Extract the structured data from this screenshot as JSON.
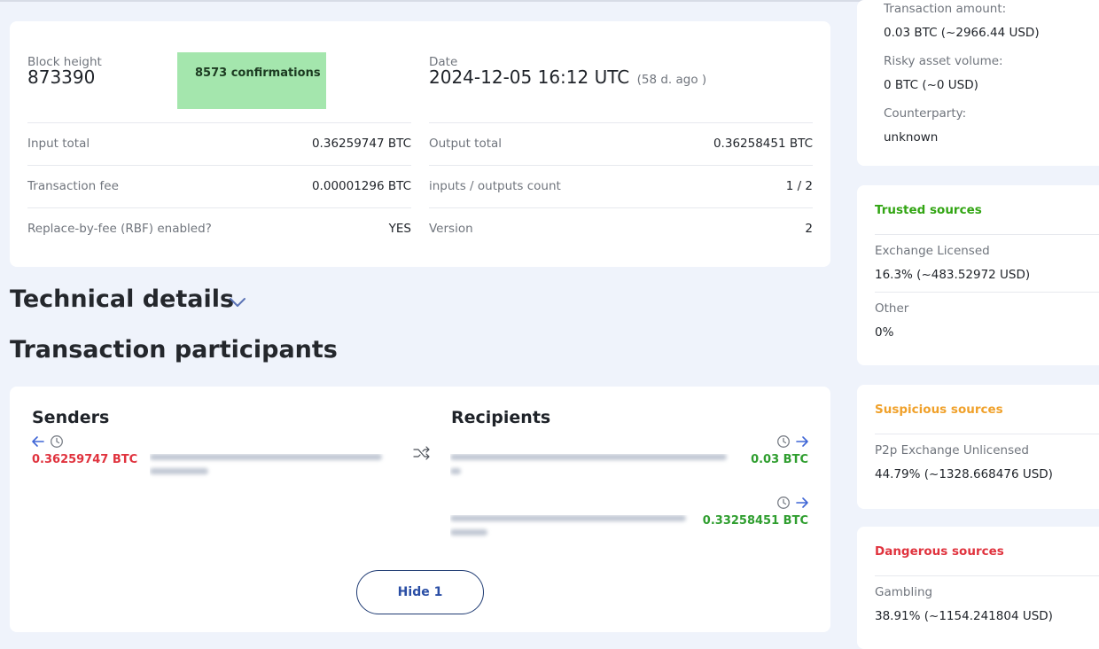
{
  "summary": {
    "block_height_label": "Block height",
    "block_height_value": "873390",
    "confirmations": "8573 confirmations",
    "date_label": "Date",
    "date_value": "2024-12-05 16:12 UTC",
    "date_ago": "(58 d. ago )",
    "rows_left": [
      {
        "label": "Input total",
        "value": "0.36259747 BTC"
      },
      {
        "label": "Transaction fee",
        "value": "0.00001296 BTC"
      },
      {
        "label": "Replace-by-fee (RBF) enabled?",
        "value": "YES"
      }
    ],
    "rows_right": [
      {
        "label": "Output total",
        "value": "0.36258451 BTC"
      },
      {
        "label": "inputs / outputs count",
        "value": "1 / 2"
      },
      {
        "label": "Version",
        "value": "2"
      }
    ]
  },
  "technical_details": {
    "title": "Technical details",
    "icon": "chevron-down-icon"
  },
  "participants": {
    "title": "Transaction participants",
    "senders_title": "Senders",
    "recipients_title": "Recipients",
    "senders": [
      {
        "amount": "0.36259747 BTC"
      }
    ],
    "recipients": [
      {
        "amount": "0.03 BTC"
      },
      {
        "amount": "0.33258451 BTC"
      }
    ],
    "hide_button": "Hide 1",
    "colors": {
      "sender": "#e0333e",
      "recipient": "#2f9e2f"
    }
  },
  "risk": {
    "transaction_amount_label": "Transaction amount:",
    "transaction_amount_value": "0.03 BTC (~2966.44 USD)",
    "risky_volume_label": "Risky asset volume:",
    "risky_volume_value": "0 BTC (~0 USD)",
    "counterparty_label": "Counterparty:",
    "counterparty_value": "unknown",
    "trusted": {
      "title": "Trusted sources",
      "color": "#32a513",
      "items": [
        {
          "name": "Exchange Licensed",
          "value": "16.3% (~483.52972 USD)"
        },
        {
          "name": "Other",
          "value": "0%"
        }
      ]
    },
    "suspicious": {
      "title": "Suspicious sources",
      "color": "#f0a12b",
      "items": [
        {
          "name": "P2p Exchange Unlicensed",
          "value": "44.79% (~1328.668476 USD)"
        }
      ]
    },
    "dangerous": {
      "title": "Dangerous sources",
      "color": "#e0333e",
      "items": [
        {
          "name": "Gambling",
          "value": "38.91% (~1154.241804 USD)"
        }
      ]
    }
  }
}
